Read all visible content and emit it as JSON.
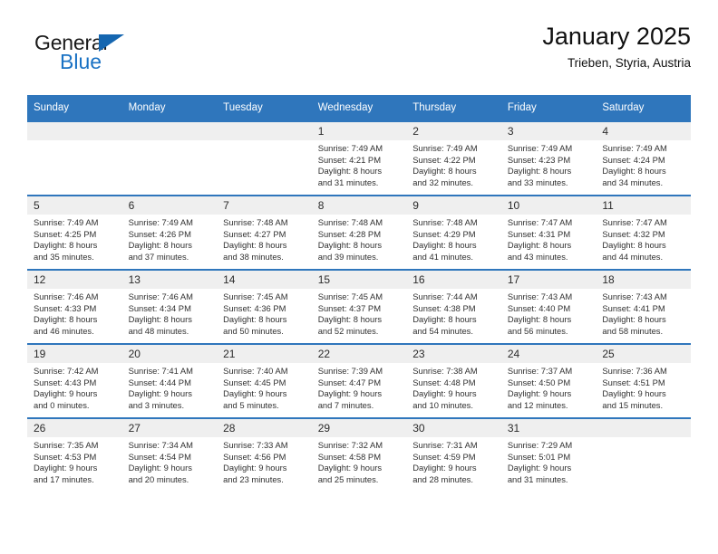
{
  "brand": {
    "name_top": "General",
    "name_bottom": "Blue",
    "accent_color": "#1a72c4",
    "triangle_color": "#1566b0"
  },
  "header": {
    "title": "January 2025",
    "location": "Trieben, Styria, Austria"
  },
  "theme": {
    "header_row_bg": "#2f76bc",
    "day_number_bg": "#efefef",
    "row_divider": "#2f76bc"
  },
  "weekdays": [
    "Sunday",
    "Monday",
    "Tuesday",
    "Wednesday",
    "Thursday",
    "Friday",
    "Saturday"
  ],
  "labels": {
    "sunrise": "Sunrise:",
    "sunset": "Sunset:",
    "daylight": "Daylight:"
  },
  "weeks": [
    [
      {
        "day": "",
        "sunrise": "",
        "sunset": "",
        "daylight_1": "",
        "daylight_2": ""
      },
      {
        "day": "",
        "sunrise": "",
        "sunset": "",
        "daylight_1": "",
        "daylight_2": ""
      },
      {
        "day": "",
        "sunrise": "",
        "sunset": "",
        "daylight_1": "",
        "daylight_2": ""
      },
      {
        "day": "1",
        "sunrise": "Sunrise: 7:49 AM",
        "sunset": "Sunset: 4:21 PM",
        "daylight_1": "Daylight: 8 hours",
        "daylight_2": "and 31 minutes."
      },
      {
        "day": "2",
        "sunrise": "Sunrise: 7:49 AM",
        "sunset": "Sunset: 4:22 PM",
        "daylight_1": "Daylight: 8 hours",
        "daylight_2": "and 32 minutes."
      },
      {
        "day": "3",
        "sunrise": "Sunrise: 7:49 AM",
        "sunset": "Sunset: 4:23 PM",
        "daylight_1": "Daylight: 8 hours",
        "daylight_2": "and 33 minutes."
      },
      {
        "day": "4",
        "sunrise": "Sunrise: 7:49 AM",
        "sunset": "Sunset: 4:24 PM",
        "daylight_1": "Daylight: 8 hours",
        "daylight_2": "and 34 minutes."
      }
    ],
    [
      {
        "day": "5",
        "sunrise": "Sunrise: 7:49 AM",
        "sunset": "Sunset: 4:25 PM",
        "daylight_1": "Daylight: 8 hours",
        "daylight_2": "and 35 minutes."
      },
      {
        "day": "6",
        "sunrise": "Sunrise: 7:49 AM",
        "sunset": "Sunset: 4:26 PM",
        "daylight_1": "Daylight: 8 hours",
        "daylight_2": "and 37 minutes."
      },
      {
        "day": "7",
        "sunrise": "Sunrise: 7:48 AM",
        "sunset": "Sunset: 4:27 PM",
        "daylight_1": "Daylight: 8 hours",
        "daylight_2": "and 38 minutes."
      },
      {
        "day": "8",
        "sunrise": "Sunrise: 7:48 AM",
        "sunset": "Sunset: 4:28 PM",
        "daylight_1": "Daylight: 8 hours",
        "daylight_2": "and 39 minutes."
      },
      {
        "day": "9",
        "sunrise": "Sunrise: 7:48 AM",
        "sunset": "Sunset: 4:29 PM",
        "daylight_1": "Daylight: 8 hours",
        "daylight_2": "and 41 minutes."
      },
      {
        "day": "10",
        "sunrise": "Sunrise: 7:47 AM",
        "sunset": "Sunset: 4:31 PM",
        "daylight_1": "Daylight: 8 hours",
        "daylight_2": "and 43 minutes."
      },
      {
        "day": "11",
        "sunrise": "Sunrise: 7:47 AM",
        "sunset": "Sunset: 4:32 PM",
        "daylight_1": "Daylight: 8 hours",
        "daylight_2": "and 44 minutes."
      }
    ],
    [
      {
        "day": "12",
        "sunrise": "Sunrise: 7:46 AM",
        "sunset": "Sunset: 4:33 PM",
        "daylight_1": "Daylight: 8 hours",
        "daylight_2": "and 46 minutes."
      },
      {
        "day": "13",
        "sunrise": "Sunrise: 7:46 AM",
        "sunset": "Sunset: 4:34 PM",
        "daylight_1": "Daylight: 8 hours",
        "daylight_2": "and 48 minutes."
      },
      {
        "day": "14",
        "sunrise": "Sunrise: 7:45 AM",
        "sunset": "Sunset: 4:36 PM",
        "daylight_1": "Daylight: 8 hours",
        "daylight_2": "and 50 minutes."
      },
      {
        "day": "15",
        "sunrise": "Sunrise: 7:45 AM",
        "sunset": "Sunset: 4:37 PM",
        "daylight_1": "Daylight: 8 hours",
        "daylight_2": "and 52 minutes."
      },
      {
        "day": "16",
        "sunrise": "Sunrise: 7:44 AM",
        "sunset": "Sunset: 4:38 PM",
        "daylight_1": "Daylight: 8 hours",
        "daylight_2": "and 54 minutes."
      },
      {
        "day": "17",
        "sunrise": "Sunrise: 7:43 AM",
        "sunset": "Sunset: 4:40 PM",
        "daylight_1": "Daylight: 8 hours",
        "daylight_2": "and 56 minutes."
      },
      {
        "day": "18",
        "sunrise": "Sunrise: 7:43 AM",
        "sunset": "Sunset: 4:41 PM",
        "daylight_1": "Daylight: 8 hours",
        "daylight_2": "and 58 minutes."
      }
    ],
    [
      {
        "day": "19",
        "sunrise": "Sunrise: 7:42 AM",
        "sunset": "Sunset: 4:43 PM",
        "daylight_1": "Daylight: 9 hours",
        "daylight_2": "and 0 minutes."
      },
      {
        "day": "20",
        "sunrise": "Sunrise: 7:41 AM",
        "sunset": "Sunset: 4:44 PM",
        "daylight_1": "Daylight: 9 hours",
        "daylight_2": "and 3 minutes."
      },
      {
        "day": "21",
        "sunrise": "Sunrise: 7:40 AM",
        "sunset": "Sunset: 4:45 PM",
        "daylight_1": "Daylight: 9 hours",
        "daylight_2": "and 5 minutes."
      },
      {
        "day": "22",
        "sunrise": "Sunrise: 7:39 AM",
        "sunset": "Sunset: 4:47 PM",
        "daylight_1": "Daylight: 9 hours",
        "daylight_2": "and 7 minutes."
      },
      {
        "day": "23",
        "sunrise": "Sunrise: 7:38 AM",
        "sunset": "Sunset: 4:48 PM",
        "daylight_1": "Daylight: 9 hours",
        "daylight_2": "and 10 minutes."
      },
      {
        "day": "24",
        "sunrise": "Sunrise: 7:37 AM",
        "sunset": "Sunset: 4:50 PM",
        "daylight_1": "Daylight: 9 hours",
        "daylight_2": "and 12 minutes."
      },
      {
        "day": "25",
        "sunrise": "Sunrise: 7:36 AM",
        "sunset": "Sunset: 4:51 PM",
        "daylight_1": "Daylight: 9 hours",
        "daylight_2": "and 15 minutes."
      }
    ],
    [
      {
        "day": "26",
        "sunrise": "Sunrise: 7:35 AM",
        "sunset": "Sunset: 4:53 PM",
        "daylight_1": "Daylight: 9 hours",
        "daylight_2": "and 17 minutes."
      },
      {
        "day": "27",
        "sunrise": "Sunrise: 7:34 AM",
        "sunset": "Sunset: 4:54 PM",
        "daylight_1": "Daylight: 9 hours",
        "daylight_2": "and 20 minutes."
      },
      {
        "day": "28",
        "sunrise": "Sunrise: 7:33 AM",
        "sunset": "Sunset: 4:56 PM",
        "daylight_1": "Daylight: 9 hours",
        "daylight_2": "and 23 minutes."
      },
      {
        "day": "29",
        "sunrise": "Sunrise: 7:32 AM",
        "sunset": "Sunset: 4:58 PM",
        "daylight_1": "Daylight: 9 hours",
        "daylight_2": "and 25 minutes."
      },
      {
        "day": "30",
        "sunrise": "Sunrise: 7:31 AM",
        "sunset": "Sunset: 4:59 PM",
        "daylight_1": "Daylight: 9 hours",
        "daylight_2": "and 28 minutes."
      },
      {
        "day": "31",
        "sunrise": "Sunrise: 7:29 AM",
        "sunset": "Sunset: 5:01 PM",
        "daylight_1": "Daylight: 9 hours",
        "daylight_2": "and 31 minutes."
      },
      {
        "day": "",
        "sunrise": "",
        "sunset": "",
        "daylight_1": "",
        "daylight_2": ""
      }
    ]
  ]
}
